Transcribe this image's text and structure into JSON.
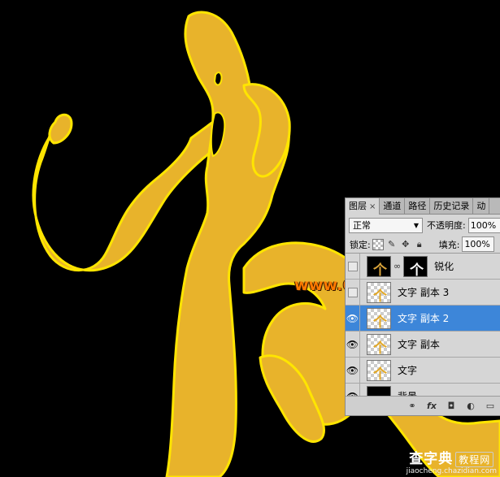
{
  "canvas": {
    "text_fill": "#e8b32b",
    "text_outline": "#ffe500",
    "background": "#000000"
  },
  "watermark": {
    "text": "www.68ps.com"
  },
  "site_mark": {
    "brand": "查字典",
    "tag": "教程网",
    "url": "jiaocheng.chazidian.com"
  },
  "panel": {
    "tabs": [
      {
        "label": "图层",
        "close": "×"
      },
      {
        "label": "通道"
      },
      {
        "label": "路径"
      },
      {
        "label": "历史记录"
      },
      {
        "label": "动"
      }
    ],
    "blend_mode": "正常",
    "opacity_label": "不透明度:",
    "opacity_value": "100%",
    "lock_label": "锁定:",
    "fill_label": "填充:",
    "fill_value": "100%",
    "layers": [
      {
        "name": "锐化",
        "visible": false,
        "selected": false
      },
      {
        "name": "文字 副本 3",
        "visible": false,
        "selected": false
      },
      {
        "name": "文字 副本 2",
        "visible": true,
        "selected": true
      },
      {
        "name": "文字 副本",
        "visible": true,
        "selected": false
      },
      {
        "name": "文字",
        "visible": true,
        "selected": false
      },
      {
        "name": "背景",
        "visible": true,
        "selected": false
      }
    ],
    "footer_icons": [
      "link-icon",
      "fx-icon",
      "mask-icon",
      "adjustment-icon",
      "folder-icon"
    ]
  },
  "colors": {
    "selection": "#3d86d9",
    "watermark": "#ff7a00"
  }
}
